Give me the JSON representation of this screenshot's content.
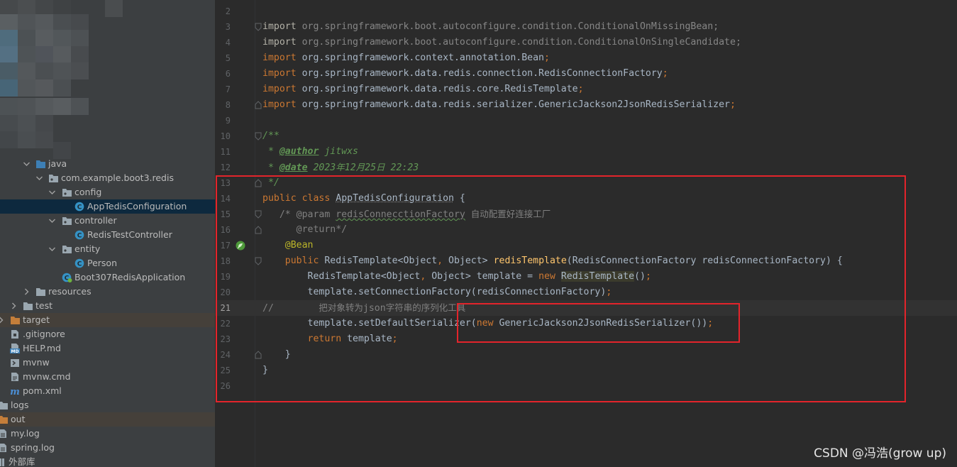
{
  "project_tree": {
    "items": [
      {
        "label": "java",
        "icon": "folder-icon",
        "color": "#3d7fb5"
      },
      {
        "label": "com.example.boot3.redis",
        "icon": "package-icon"
      },
      {
        "label": "config",
        "icon": "package-icon"
      },
      {
        "label": "AppTedisConfiguration",
        "icon": "class-icon",
        "selected": true
      },
      {
        "label": "controller",
        "icon": "package-icon"
      },
      {
        "label": "RedisTestController",
        "icon": "class-icon"
      },
      {
        "label": "entity",
        "icon": "package-icon"
      },
      {
        "label": "Person",
        "icon": "class-icon"
      },
      {
        "label": "Boot307RedisApplication",
        "icon": "spring-boot-class-icon"
      },
      {
        "label": "resources",
        "icon": "folder-icon"
      },
      {
        "label": "test",
        "icon": "folder-icon"
      },
      {
        "label": "target",
        "icon": "folder-icon",
        "color": "#c47e3a",
        "excluded": true
      },
      {
        "label": ".gitignore",
        "icon": "gitignore-file-icon"
      },
      {
        "label": "HELP.md",
        "icon": "markdown-file-icon"
      },
      {
        "label": "mvnw",
        "icon": "script-file-icon"
      },
      {
        "label": "mvnw.cmd",
        "icon": "text-file-icon"
      },
      {
        "label": "pom.xml",
        "icon": "maven-file-icon"
      },
      {
        "label": "logs",
        "icon": "folder-icon"
      },
      {
        "label": "out",
        "icon": "folder-icon",
        "color": "#c47e3a",
        "excluded": true
      },
      {
        "label": "my.log",
        "icon": "log-file-icon"
      },
      {
        "label": "spring.log",
        "icon": "log-file-icon"
      },
      {
        "label": "外部库",
        "icon": "external-libraries-icon"
      }
    ]
  },
  "editor": {
    "file": "AppTedisConfiguration",
    "current_line": 21,
    "lines": [
      {
        "n": "2",
        "t": ""
      },
      {
        "n": "3",
        "t": "import org.springframework.boot.autoconfigure.condition.ConditionalOnMissingBean;"
      },
      {
        "n": "4",
        "t": "import org.springframework.boot.autoconfigure.condition.ConditionalOnSingleCandidate;"
      },
      {
        "n": "5",
        "t": "import org.springframework.context.annotation.Bean;"
      },
      {
        "n": "6",
        "t": "import org.springframework.data.redis.connection.RedisConnectionFactory;"
      },
      {
        "n": "7",
        "t": "import org.springframework.data.redis.core.RedisTemplate;"
      },
      {
        "n": "8",
        "t": "import org.springframework.data.redis.serializer.GenericJackson2JsonRedisSerializer;"
      },
      {
        "n": "9",
        "t": ""
      },
      {
        "n": "10",
        "t": "/**"
      },
      {
        "n": "11",
        "t": " * @author jitwxs"
      },
      {
        "n": "12",
        "t": " * @date 2023年12月25日 22:23"
      },
      {
        "n": "13",
        "t": " */"
      },
      {
        "n": "14",
        "t": "public class AppTedisConfiguration {"
      },
      {
        "n": "15",
        "t": "   /* @param redisConnecctionFactory 自动配置好连接工厂"
      },
      {
        "n": "16",
        "t": "      @return*/"
      },
      {
        "n": "17",
        "t": "    @Bean"
      },
      {
        "n": "18",
        "t": "    public RedisTemplate<Object, Object> redisTemplate(RedisConnectionFactory redisConnectionFactory) {"
      },
      {
        "n": "19",
        "t": "        RedisTemplate<Object, Object> template = new RedisTemplate();"
      },
      {
        "n": "20",
        "t": "        template.setConnectionFactory(redisConnectionFactory);"
      },
      {
        "n": "21",
        "t": "//        把对象转为json字符串的序列化工具"
      },
      {
        "n": "22",
        "t": "        template.setDefaultSerializer(new GenericJackson2JsonRedisSerializer());"
      },
      {
        "n": "23",
        "t": "        return template;"
      },
      {
        "n": "24",
        "t": "    }"
      },
      {
        "n": "25",
        "t": "}"
      },
      {
        "n": "26",
        "t": ""
      }
    ]
  },
  "watermark": "CSDN @冯浩(grow up)",
  "colors": {
    "annotation_box": "#e3242b",
    "keyword": "#cc7832",
    "doc_comment": "#629755",
    "method": "#ffc66d",
    "annotation": "#bbb529"
  }
}
